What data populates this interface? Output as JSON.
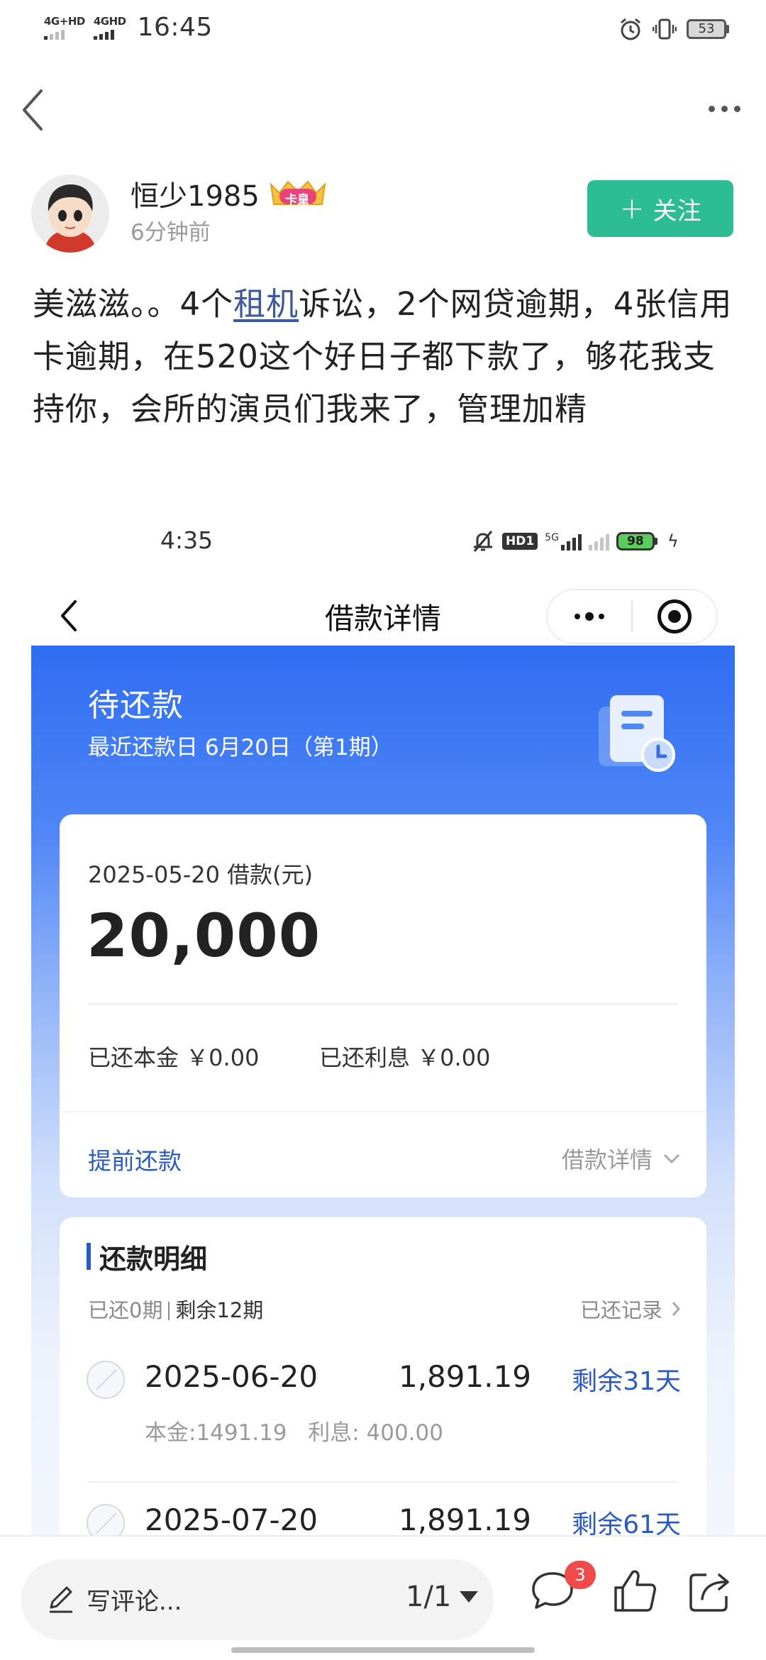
{
  "status_bar": {
    "net_labels": [
      "4G+HD",
      "4GHD"
    ],
    "time": "16:45",
    "battery": "53"
  },
  "post": {
    "author": "恒少1985",
    "badge": "卡皇",
    "time": "6分钟前",
    "follow_label": "关注",
    "text_before": "美滋滋。。4个",
    "text_link": "租机",
    "text_after": "诉讼，2个网贷逾期，4张信用卡逾期，在520这个好日子都下款了，够花我支持你，会所的演员们我来了，管理加精"
  },
  "embedded": {
    "status_time": "4:35",
    "hd_label": "HD1",
    "net_label": "5G",
    "battery": "98",
    "title": "借款详情",
    "header": {
      "title": "待还款",
      "subtitle": "最近还款日 6月20日（第1期）"
    },
    "loan": {
      "date_label": "2025-05-20 借款(元)",
      "amount": "20,000",
      "repaid_principal": "已还本金 ￥0.00",
      "repaid_interest": "已还利息 ￥0.00",
      "early_repay": "提前还款",
      "detail_link": "借款详情"
    },
    "plan": {
      "title": "还款明细",
      "paid_periods": "已还0期",
      "remaining_periods": "剩余12期",
      "records_link": "已还记录",
      "rows": [
        {
          "date": "2025-06-20",
          "amount": "1,891.19",
          "remaining": "剩余31天",
          "breakdown": "本金:1491.19   利息: 400.00"
        },
        {
          "date": "2025-07-20",
          "amount": "1,891.19",
          "remaining": "剩余61天",
          "breakdown": ""
        }
      ]
    }
  },
  "bottom_bar": {
    "comment_placeholder": "写评论...",
    "page_indicator": "1/1",
    "comment_count": "3"
  },
  "colors": {
    "follow_green": "#2dbd95",
    "link_blue": "#2a5bc4",
    "header_blue": "#2f6df2",
    "badge_red": "#f04a4a"
  },
  "icons": [
    "back-arrow-icon",
    "more-icon",
    "vip-crown-icon",
    "plus-icon",
    "document-clock-icon",
    "chevron-down-icon",
    "chevron-right-icon",
    "pen-icon",
    "comment-icon",
    "like-icon",
    "share-icon"
  ]
}
